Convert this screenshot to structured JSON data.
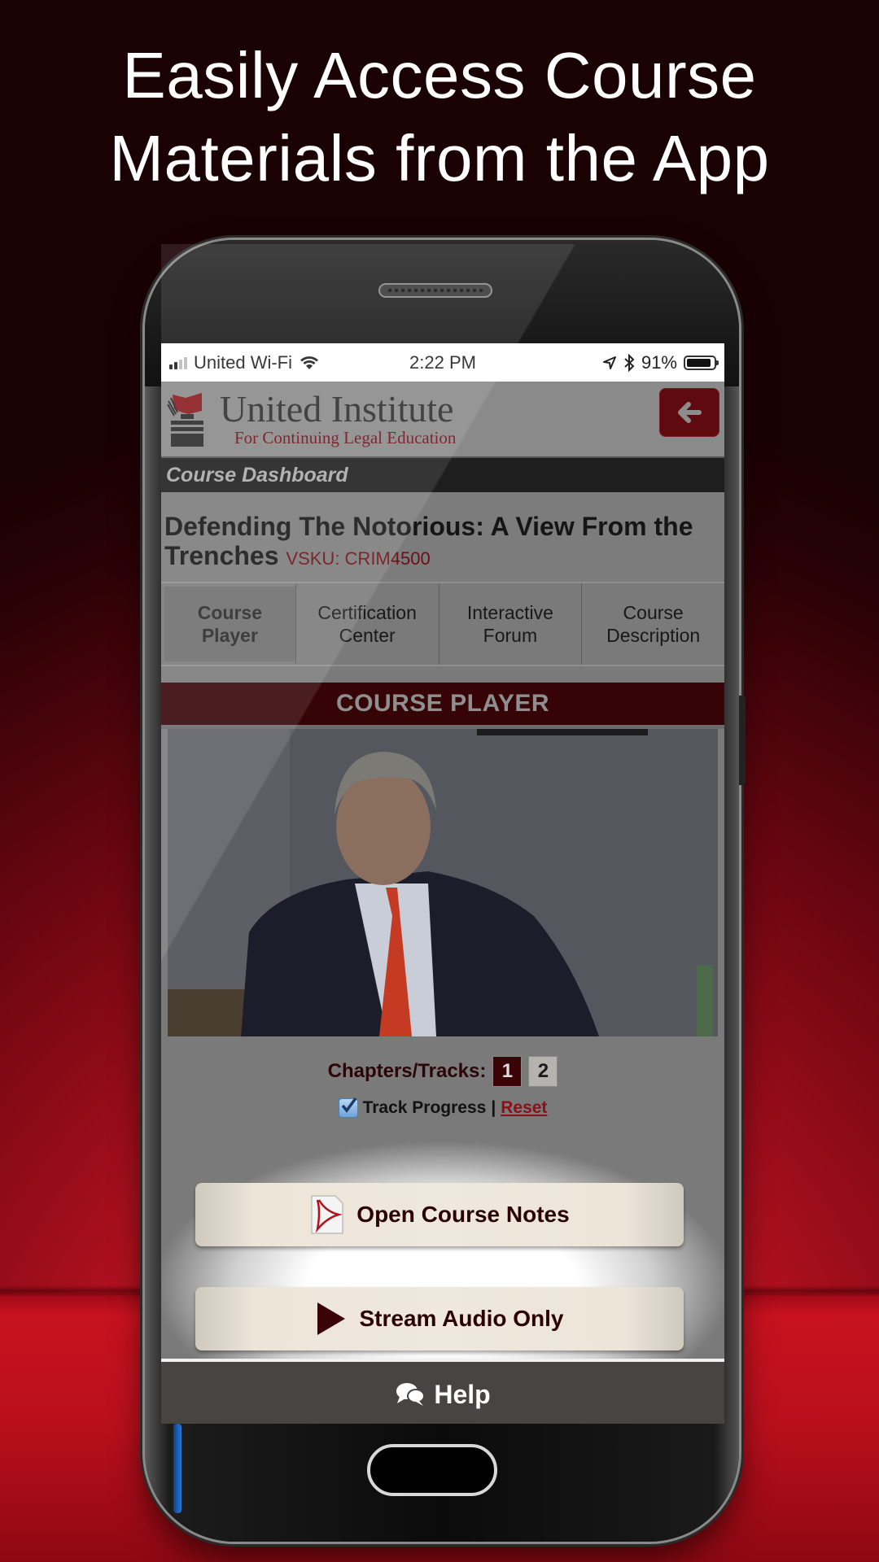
{
  "headline": {
    "line1": "Easily Access Course",
    "line2": "Materials from the App"
  },
  "status_bar": {
    "carrier": "United Wi-Fi",
    "time": "2:22 PM",
    "battery": "91%",
    "battery_level": 0.91,
    "signal_bars_active": 2,
    "signal_bars_total": 4
  },
  "app_header": {
    "brand_title": "United Institute",
    "brand_subtitle": "For Continuing Legal Education",
    "back_icon": "arrow-left-icon"
  },
  "dashboard": {
    "label": "Course Dashboard"
  },
  "course": {
    "title": "Defending The Notorious: A View From the Trenches",
    "vsku": "VSKU: CRIM4500"
  },
  "tabs": [
    {
      "line1": "Course",
      "line2": "Player",
      "active": true
    },
    {
      "line1": "Certification",
      "line2": "Center",
      "active": false
    },
    {
      "line1": "Interactive",
      "line2": "Forum",
      "active": false
    },
    {
      "line1": "Course",
      "line2": "Description",
      "active": false
    }
  ],
  "player": {
    "section_title": "COURSE PLAYER",
    "video_description": "Man in dark suit and red tie speaking",
    "chapters_label": "Chapters/Tracks:",
    "chapters": [
      "1",
      "2"
    ],
    "active_chapter": "1",
    "track_progress_label": "Track Progress",
    "track_progress_checked": true,
    "separator": "|",
    "reset_label": "Reset"
  },
  "actions": {
    "open_notes_label": "Open Course Notes",
    "open_notes_icon": "pdf-icon",
    "stream_audio_label": "Stream Audio Only",
    "stream_audio_icon": "play-icon"
  },
  "help": {
    "label": "Help",
    "icon": "chat-bubbles-icon"
  },
  "colors": {
    "brand_red": "#6e1018",
    "player_bar": "#360407",
    "help_bar": "#474541",
    "button_cream": "#efe8dc",
    "background_red": "#c8121f"
  }
}
